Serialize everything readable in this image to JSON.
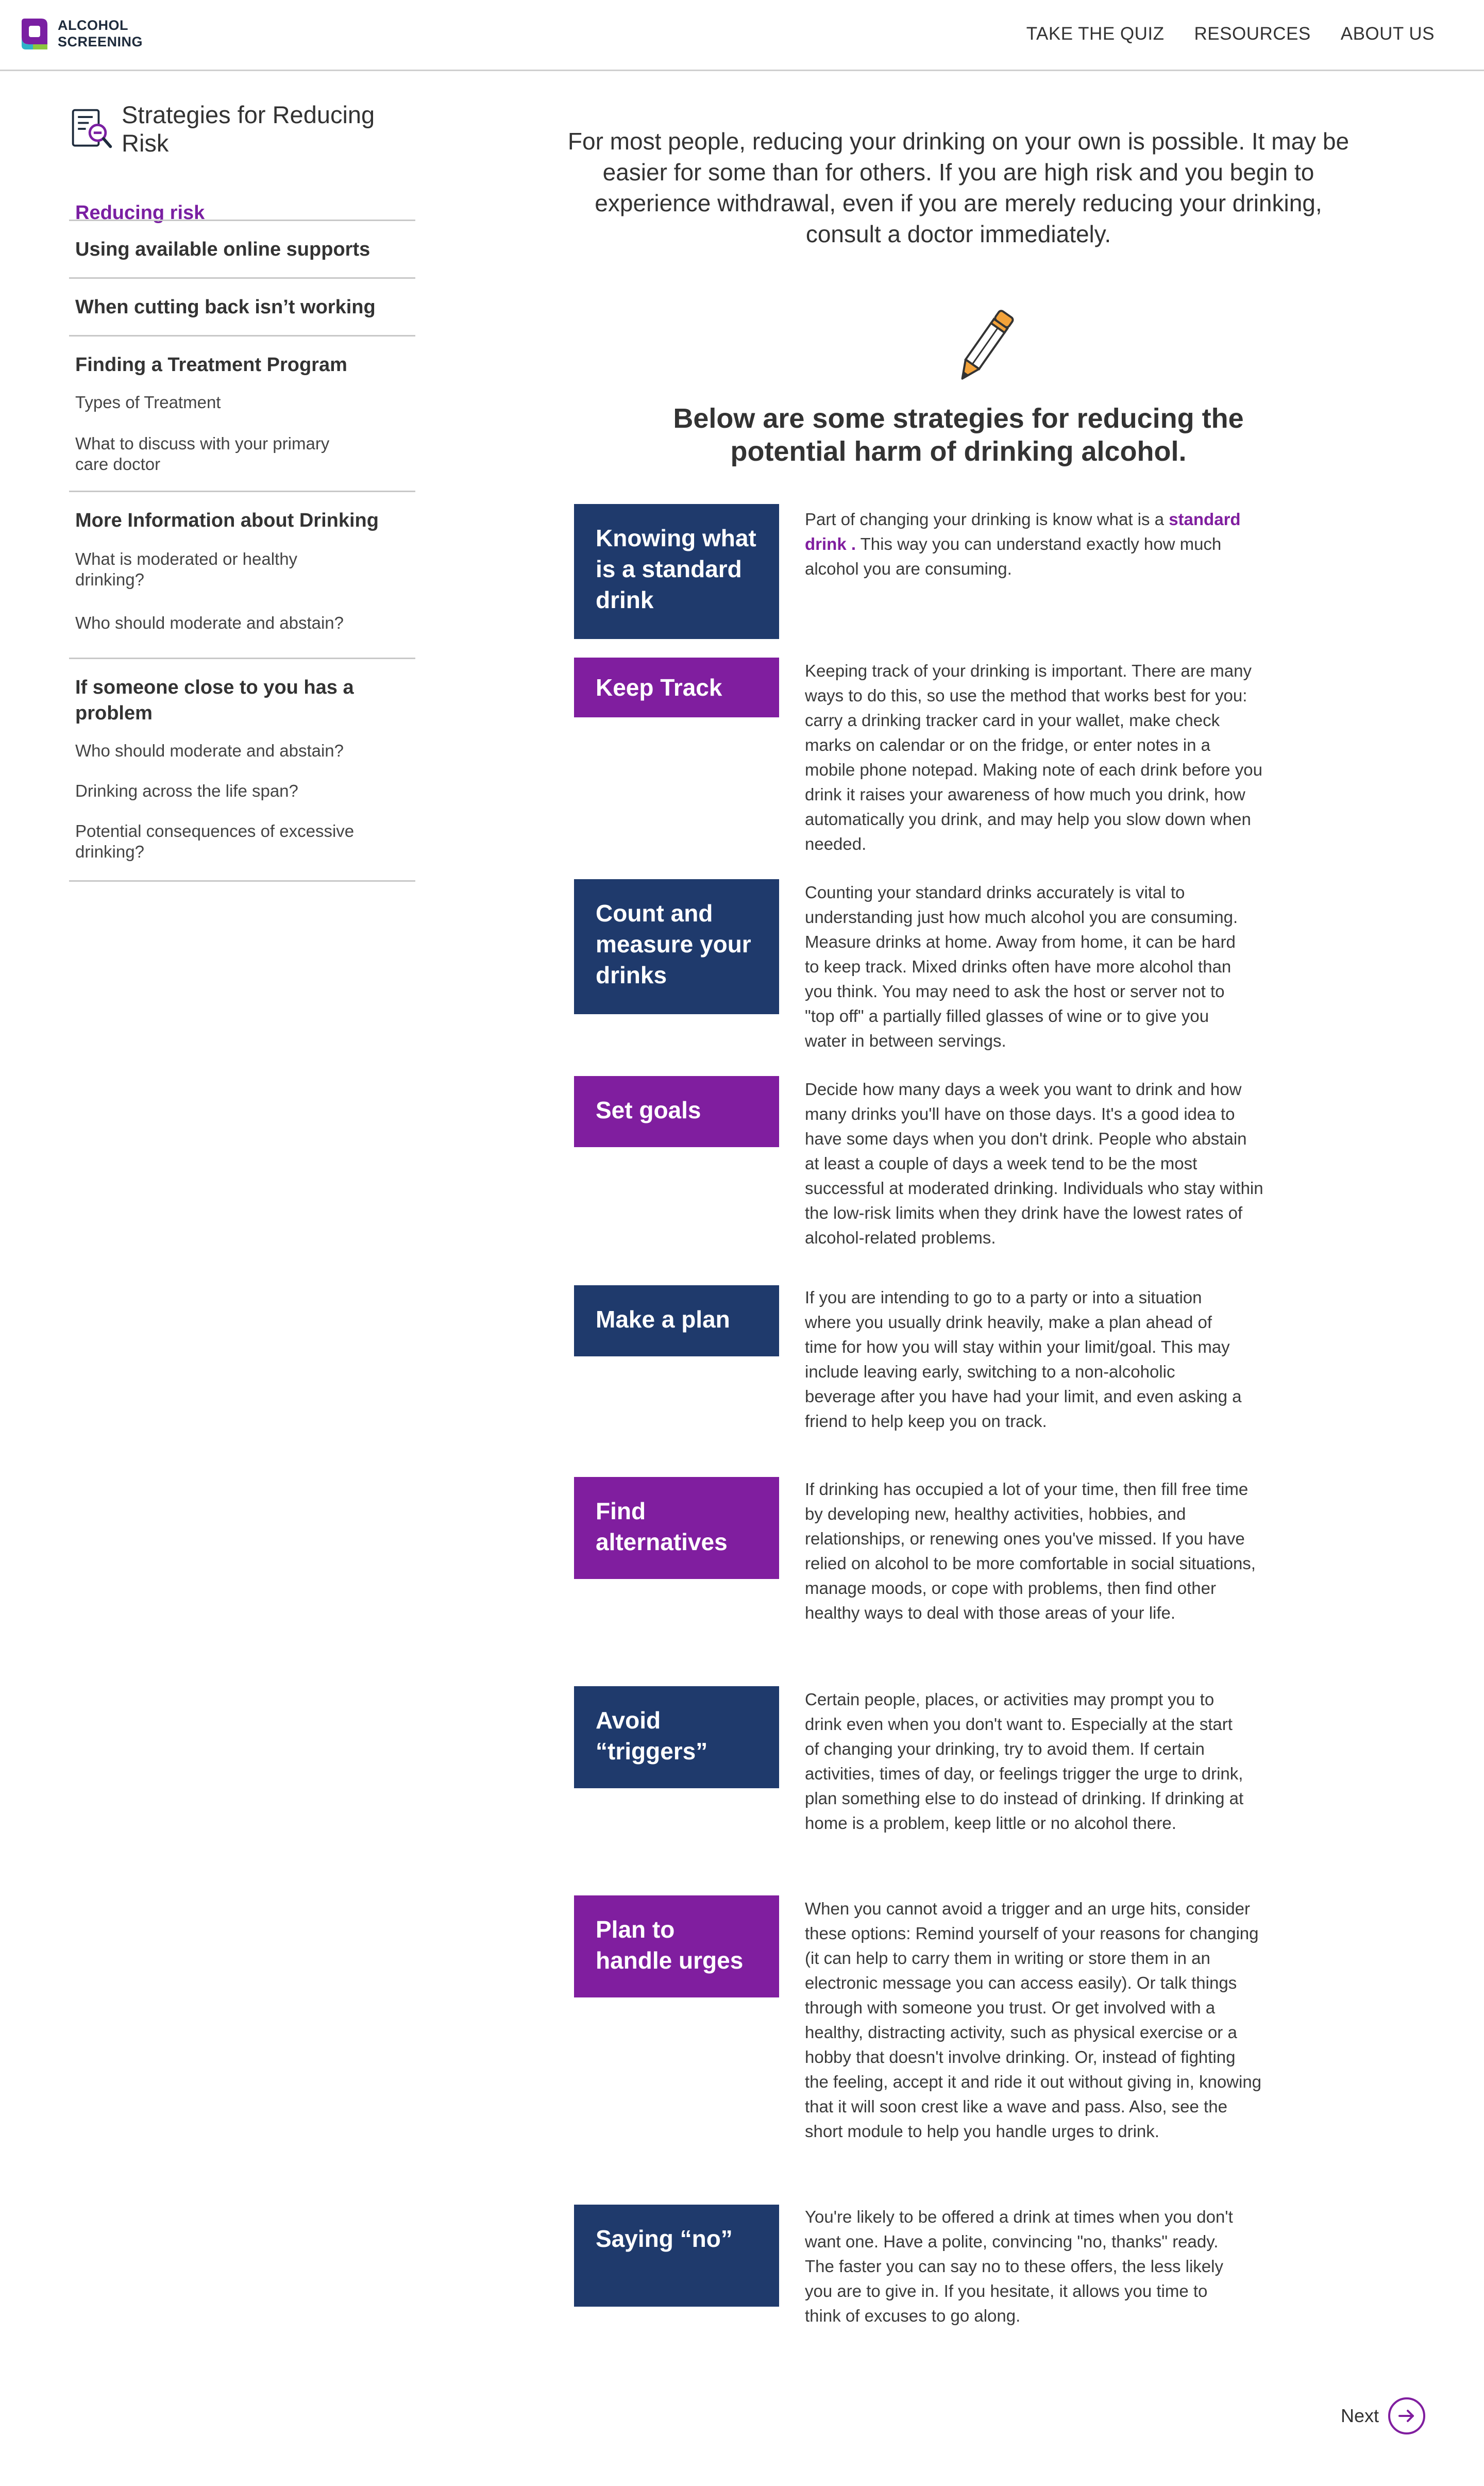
{
  "header": {
    "logo_line1": "ALCOHOL",
    "logo_line2": "SCREENING",
    "nav": [
      "TAKE THE QUIZ",
      "RESOURCES",
      "ABOUT US"
    ]
  },
  "sidebar": {
    "title": "Strategies for Reducing Risk",
    "active_item": "Reducing risk",
    "sections": [
      {
        "title": "Using available online supports",
        "items": []
      },
      {
        "title": "When cutting back isn’t working",
        "items": []
      },
      {
        "title": "Finding a Treatment Program",
        "items": [
          "Types of Treatment",
          "What to discuss with your primary care doctor"
        ]
      },
      {
        "title": "More Information about Drinking",
        "items": [
          "What is moderated or healthy drinking?",
          "Who should moderate and abstain?"
        ]
      },
      {
        "title": "If someone close to you has a problem",
        "items": [
          "Who should moderate and abstain?",
          "Drinking across the life span?",
          "Potential consequences of excessive drinking?"
        ]
      }
    ]
  },
  "main": {
    "intro": "For most people, reducing your drinking on your own is possible. It may be easier for some than for others.  If you are high risk and you begin to experience withdrawal, even if you are merely reducing your drinking, consult a doctor immediately.",
    "subhead": "Below are some strategies for reducing the potential harm of drinking alcohol.",
    "strategies": [
      {
        "label": "Knowing what is a standard drink",
        "text_before": "Part of changing your drinking is know what is a ",
        "link": "standard drink .",
        "text_after": " This way you can understand exactly how much alcohol you are consuming."
      },
      {
        "label": "Keep Track",
        "text": "Keeping track of your drinking is important. There are many ways to do this, so use the method that works best for you: carry a drinking tracker card in your wallet, make check marks on calendar or on the fridge, or enter notes in a mobile phone notepad. Making note of each drink before you drink it raises your awareness of how much you drink, how automatically you drink, and may help you slow down when needed."
      },
      {
        "label": "Count and measure your drinks",
        "text": "Counting your standard drinks accurately is vital to understanding just how much alcohol you are consuming. Measure drinks at home. Away from home, it can be hard to keep track. Mixed drinks often have more alcohol than you think. You may need to ask the host or server not to \"top off\" a partially filled glasses of wine or to give you water in between servings."
      },
      {
        "label": "Set goals",
        "text": "Decide how many days a week you want to drink and how many drinks you'll have on those days. It's a good idea to have some days when you don't drink. People who abstain at least a couple of days a week tend to be the most successful at moderated drinking. Individuals who stay within the low-risk limits when they drink have the lowest rates of alcohol-related problems."
      },
      {
        "label": "Make a plan",
        "text": "If you are intending to go to a party or into a situation where you usually drink heavily, make a plan ahead of time for how you will stay within your limit/goal. This may include leaving early, switching to a non-alcoholic beverage after you have had your limit, and even asking a friend to help keep you on track."
      },
      {
        "label": "Find alternatives",
        "text": " If drinking has occupied a lot of your time, then fill free time by developing new, healthy activities, hobbies, and relationships, or renewing ones you've missed. If you have relied on alcohol to be more comfortable in social situations, manage moods, or cope with problems, then find other healthy ways to deal with those areas of your life."
      },
      {
        "label": "Avoid “triggers”",
        "text": "Certain people, places, or activities may prompt you to drink even when you don't want to. Especially at the start of changing your drinking, try to avoid them. If certain activities, times of day, or feelings trigger the urge to drink, plan something else to do instead of drinking. If drinking at home is a problem, keep little or no alcohol there."
      },
      {
        "label": "Plan to handle urges",
        "text": "When you cannot avoid a trigger and an urge hits, consider these options: Remind yourself of your reasons for changing (it can help to carry them in writing or store them in an electronic message you can access easily). Or talk things through with someone you trust. Or get involved with a healthy, distracting activity, such as physical exercise or a hobby that doesn't involve drinking. Or, instead of fighting the feeling, accept it and ride it out without giving in, knowing that it will soon crest like a wave and pass. Also, see the short module to help you handle urges to drink."
      },
      {
        "label": "Saying “no”",
        "text": "You're likely to be offered a drink at times when you don't want one. Have a polite, convincing \"no, thanks\" ready. The faster you can say no to these offers, the less likely you are to give in. If you hesitate, it allows you time to think of excuses to go along."
      }
    ],
    "next_label": "Next"
  },
  "colors": {
    "navy": "#1f3a6c",
    "purple": "#801e9f"
  },
  "icons": [
    "logo-mark",
    "checklist-magnifier-icon",
    "pencil-icon",
    "arrow-right-icon"
  ]
}
